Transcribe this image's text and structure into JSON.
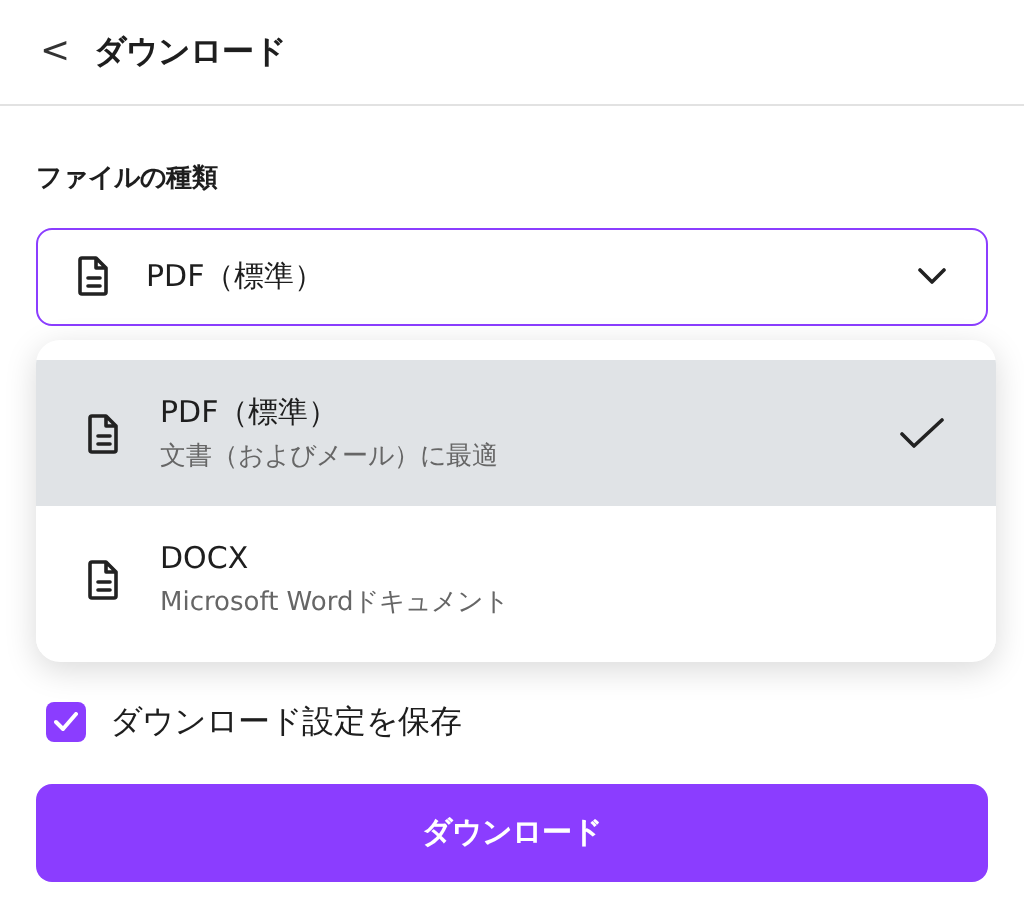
{
  "header": {
    "back": "<",
    "title": "ダウンロード"
  },
  "file_type": {
    "label": "ファイルの種類",
    "value": "PDF（標準）",
    "expanded": true
  },
  "options": [
    {
      "name": "PDF（標準）",
      "description": "文書（およびメール）に最適",
      "selected": true
    },
    {
      "name": "DOCX",
      "description": "Microsoft Wordドキュメント",
      "selected": false
    }
  ],
  "save_settings": {
    "label": "ダウンロード設定を保存",
    "checked": true
  },
  "download_button": "ダウンロード"
}
